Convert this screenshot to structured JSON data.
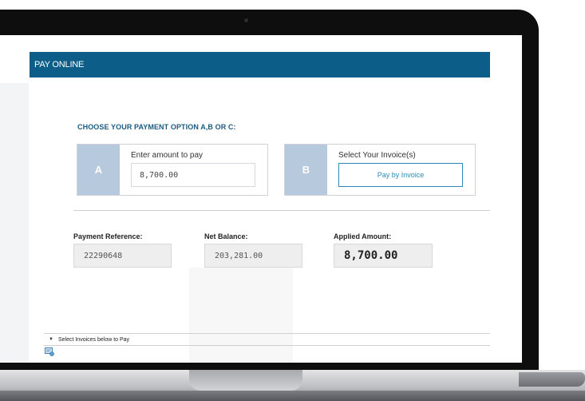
{
  "header": {
    "title": "PAY ONLINE"
  },
  "payment_options": {
    "heading": "CHOOSE YOUR PAYMENT OPTION A,B OR C:",
    "option_a": {
      "letter": "A",
      "label": "Enter amount to pay",
      "amount_value": "8,700.00"
    },
    "option_b": {
      "letter": "B",
      "label": "Select Your Invoice(s)",
      "button_label": "Pay by Invoice"
    }
  },
  "summary": {
    "payment_reference_label": "Payment Reference:",
    "payment_reference_value": "22290648",
    "net_balance_label": "Net Balance:",
    "net_balance_value": "203,281.00",
    "applied_amount_label": "Applied Amount:",
    "applied_amount_value": "8,700.00"
  },
  "invoices_section": {
    "toggle_label": "Select Invoices below to Pay",
    "toggle_icon": "triangle-down-icon",
    "tool_icon": "invoice-calculator-icon"
  },
  "colors": {
    "header_bg": "#0c5d87",
    "option_letter_bg": "#b7c9dd",
    "accent": "#2a8ab8",
    "heading_text": "#1b5b80"
  }
}
